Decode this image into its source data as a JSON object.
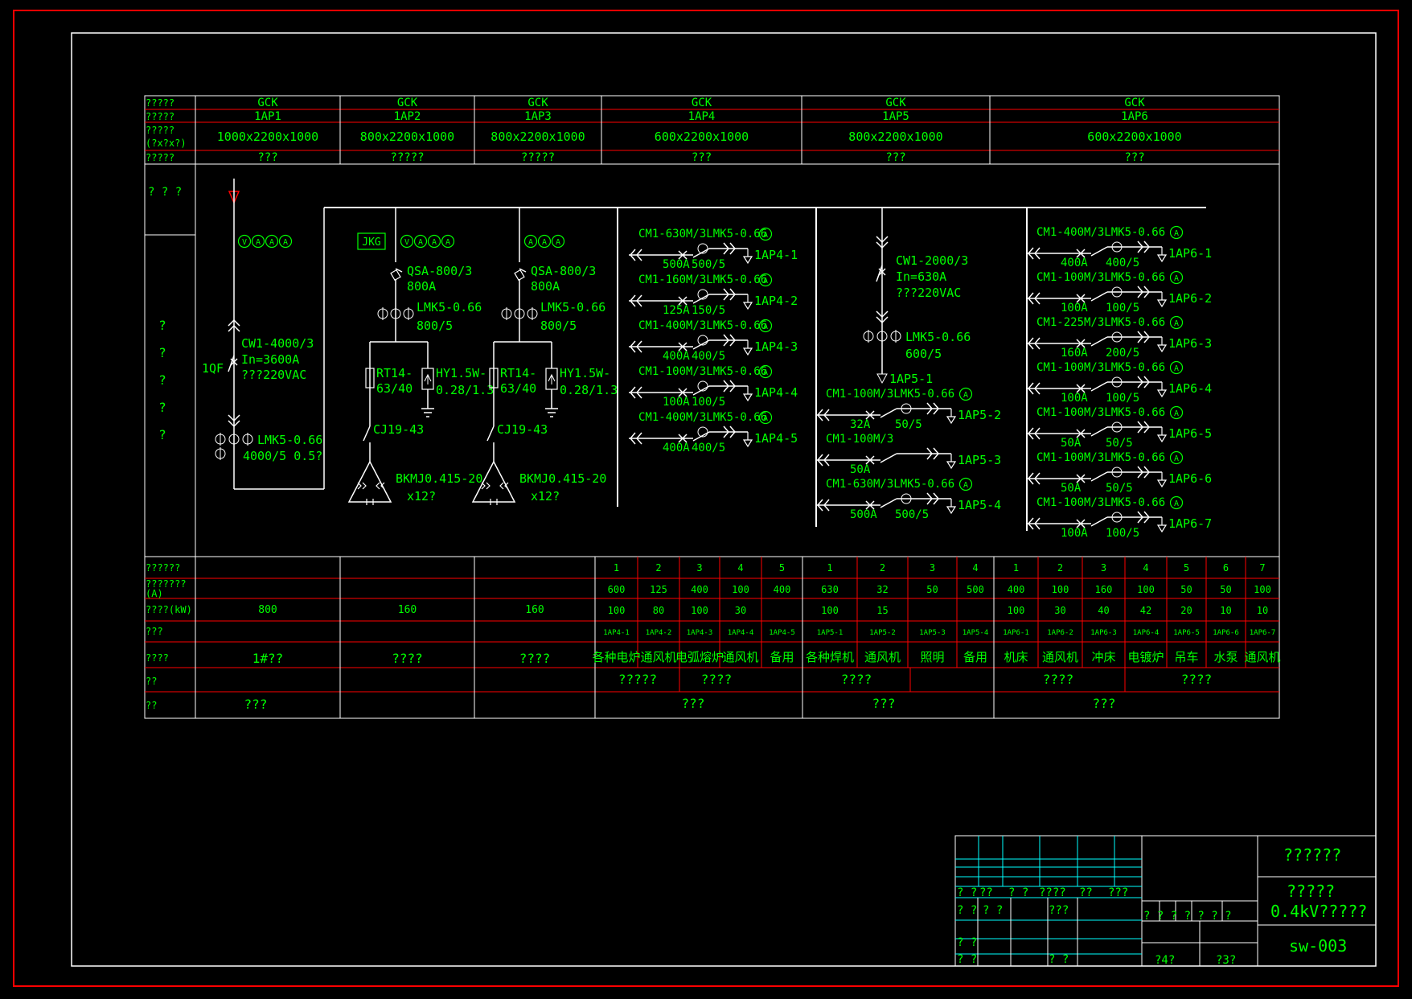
{
  "colors": {
    "background": "#000000",
    "frame": "#ff0000",
    "line": "#ffffff",
    "text": "#00ff00",
    "grid": "#ff0000",
    "titleblock_grid": "#00ffff"
  },
  "header": {
    "row_labels": [
      "?????",
      "?????",
      "?????",
      "(?x?x?)",
      "?????"
    ],
    "panels": [
      {
        "type": "GCK",
        "id": "1AP1",
        "size": "1000x2200x1000",
        "use": "???"
      },
      {
        "type": "GCK",
        "id": "1AP2",
        "size": "800x2200x1000",
        "use": "?????"
      },
      {
        "type": "GCK",
        "id": "1AP3",
        "size": "800x2200x1000",
        "use": "?????"
      },
      {
        "type": "GCK",
        "id": "1AP4",
        "size": "600x2200x1000",
        "use": "???"
      },
      {
        "type": "GCK",
        "id": "1AP5",
        "size": "800x2200x1000",
        "use": "???"
      },
      {
        "type": "GCK",
        "id": "1AP6",
        "size": "600x2200x1000",
        "use": "???"
      }
    ]
  },
  "diagram": {
    "left_label_top": "? ? ?",
    "left_label_marks": [
      "?",
      "?",
      "?",
      "?",
      "?"
    ],
    "p1": {
      "meters": "VAAA",
      "breaker": "CW1-4000/3",
      "rating": "In=3600A",
      "voltage": "???220VAC",
      "qf": "1QF",
      "ct": "LMK5-0.66",
      "ct_ratio": "4000/5 0.5?"
    },
    "p2": {
      "jkg": "JKG",
      "meters": "VAAA",
      "switch": "QSA-800/3",
      "switch_rating": "800A",
      "ct": "LMK5-0.66",
      "ct_ratio": "800/5",
      "fuse": "RT14-",
      "fuse_rating": "63/40",
      "arrester": "HY1.5W-",
      "arrester_rating": "0.28/1.3",
      "contactor": "CJ19-43",
      "capacitor": "BKMJ0.415-20",
      "capacitor_qty": "x12?"
    },
    "p3": {
      "meters": "AAA",
      "switch": "QSA-800/3",
      "switch_rating": "800A",
      "ct": "LMK5-0.66",
      "ct_ratio": "800/5",
      "fuse": "RT14-",
      "fuse_rating": "63/40",
      "arrester": "HY1.5W-",
      "arrester_rating": "0.28/1.3",
      "contactor": "CJ19-43",
      "capacitor": "BKMJ0.415-20",
      "capacitor_qty": "x12?"
    },
    "p4": [
      {
        "label": "CM1-630M/3LMK5-0.66",
        "amp": "500A",
        "ratio": "500/5",
        "out": "1AP4-1"
      },
      {
        "label": "CM1-160M/3LMK5-0.66",
        "amp": "125A",
        "ratio": "150/5",
        "out": "1AP4-2"
      },
      {
        "label": "CM1-400M/3LMK5-0.66",
        "amp": "400A",
        "ratio": "400/5",
        "out": "1AP4-3"
      },
      {
        "label": "CM1-100M/3LMK5-0.66",
        "amp": "100A",
        "ratio": "100/5",
        "out": "1AP4-4"
      },
      {
        "label": "CM1-400M/3LMK5-0.66",
        "amp": "400A",
        "ratio": "400/5",
        "out": "1AP4-5"
      }
    ],
    "p5_main": {
      "breaker": "CW1-2000/3",
      "rating": "In=630A",
      "voltage": "???220VAC",
      "ct": "LMK5-0.66",
      "ct_ratio": "600/5",
      "out": "1AP5-1"
    },
    "p5": [
      {
        "label": "CM1-100M/3LMK5-0.66",
        "amp": "32A",
        "ratio": "50/5",
        "out": "1AP5-2",
        "ct": true
      },
      {
        "label": "CM1-100M/3",
        "amp": "50A",
        "ratio": "",
        "out": "1AP5-3",
        "ct": false
      },
      {
        "label": "CM1-630M/3LMK5-0.66",
        "amp": "500A",
        "ratio": "500/5",
        "out": "1AP5-4",
        "ct": true
      }
    ],
    "p6": [
      {
        "label": "CM1-400M/3LMK5-0.66",
        "amp": "400A",
        "ratio": "400/5",
        "out": "1AP6-1"
      },
      {
        "label": "CM1-100M/3LMK5-0.66",
        "amp": "100A",
        "ratio": "100/5",
        "out": "1AP6-2"
      },
      {
        "label": "CM1-225M/3LMK5-0.66",
        "amp": "160A",
        "ratio": "200/5",
        "out": "1AP6-3"
      },
      {
        "label": "CM1-100M/3LMK5-0.66",
        "amp": "100A",
        "ratio": "100/5",
        "out": "1AP6-4"
      },
      {
        "label": "CM1-100M/3LMK5-0.66",
        "amp": "50A",
        "ratio": "50/5",
        "out": "1AP6-5"
      },
      {
        "label": "CM1-100M/3LMK5-0.66",
        "amp": "50A",
        "ratio": "50/5",
        "out": "1AP6-6"
      },
      {
        "label": "CM1-100M/3LMK5-0.66",
        "amp": "100A",
        "ratio": "100/5",
        "out": "1AP6-7"
      }
    ]
  },
  "bottom": {
    "row_labels": [
      "??????",
      "???????",
      "(A)",
      "????(kW)",
      "???",
      "????",
      "??",
      "??"
    ],
    "wide": [
      {
        "no": "",
        "current": "",
        "power": "800",
        "id": "",
        "name": "1#??",
        "remark": "",
        "unit": "???"
      },
      {
        "no": "",
        "current": "",
        "power": "160",
        "id": "",
        "name": "????",
        "remark": "",
        "unit": ""
      },
      {
        "no": "",
        "current": "",
        "power": "160",
        "id": "",
        "name": "????",
        "remark": "",
        "unit": ""
      }
    ],
    "circuits": [
      {
        "no": "1",
        "current": "600",
        "power": "100",
        "id": "1AP4-1",
        "name": "各种电炉"
      },
      {
        "no": "2",
        "current": "125",
        "power": "80",
        "id": "1AP4-2",
        "name": "通风机"
      },
      {
        "no": "3",
        "current": "400",
        "power": "100",
        "id": "1AP4-3",
        "name": "电弧熔炉"
      },
      {
        "no": "4",
        "current": "100",
        "power": "30",
        "id": "1AP4-4",
        "name": "通风机"
      },
      {
        "no": "5",
        "current": "400",
        "power": "",
        "id": "1AP4-5",
        "name": "备用"
      },
      {
        "no": "1",
        "current": "630",
        "power": "100",
        "id": "1AP5-1",
        "name": "各种焊机"
      },
      {
        "no": "2",
        "current": "32",
        "power": "15",
        "id": "1AP5-2",
        "name": "通风机"
      },
      {
        "no": "3",
        "current": "50",
        "power": "",
        "id": "1AP5-3",
        "name": "照明"
      },
      {
        "no": "4",
        "current": "500",
        "power": "",
        "id": "1AP5-4",
        "name": "备用"
      },
      {
        "no": "1",
        "current": "400",
        "power": "100",
        "id": "1AP6-1",
        "name": "机床"
      },
      {
        "no": "2",
        "current": "100",
        "power": "30",
        "id": "1AP6-2",
        "name": "通风机"
      },
      {
        "no": "3",
        "current": "160",
        "power": "40",
        "id": "1AP6-3",
        "name": "冲床"
      },
      {
        "no": "4",
        "current": "100",
        "power": "42",
        "id": "1AP6-4",
        "name": "电镀炉"
      },
      {
        "no": "5",
        "current": "50",
        "power": "20",
        "id": "1AP6-5",
        "name": "吊车"
      },
      {
        "no": "6",
        "current": "50",
        "power": "10",
        "id": "1AP6-6",
        "name": "水泵"
      },
      {
        "no": "7",
        "current": "100",
        "power": "10",
        "id": "1AP6-7",
        "name": "通风机"
      }
    ],
    "remarks": [
      "?????",
      "????",
      "????",
      "????",
      "????"
    ],
    "units": [
      "???",
      "???",
      "???"
    ]
  },
  "titleblock": {
    "title1": "??????",
    "title2": "?????",
    "title3": "0.4kV?????",
    "drawing_no": "sw-003",
    "sign_row1": [
      "? ?",
      "??",
      "? ?",
      "????",
      "??",
      "???"
    ],
    "sign_row2": [
      "? ?",
      "? ?",
      "???"
    ],
    "sign_row3": [
      "? ?"
    ],
    "sign_row4": [
      "? ?",
      "? ?"
    ],
    "scale_labels": "? ? ?     ? ? ? ?",
    "sheets": "?4?",
    "sheet_no": "?3?"
  }
}
